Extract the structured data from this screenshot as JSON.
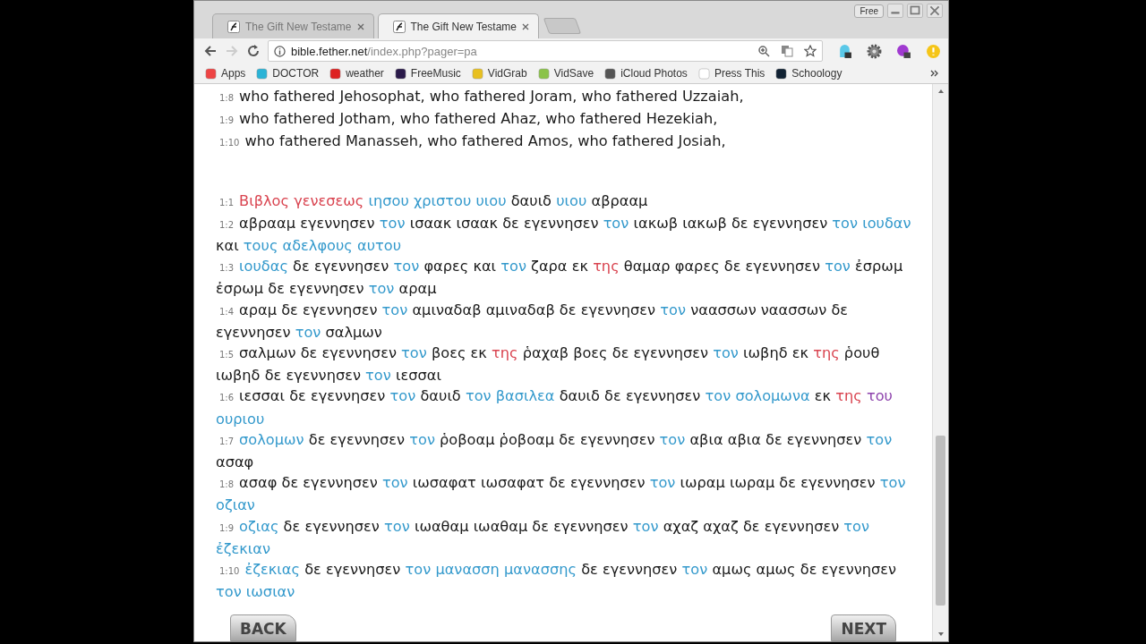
{
  "window": {
    "controls_label": "Free"
  },
  "tabs": [
    {
      "title": "The Gift New Testame",
      "selected": false
    },
    {
      "title": "The Gift New Testame",
      "selected": true
    }
  ],
  "address_bar": {
    "host": "bible.fether.net",
    "path": "/index.php?pager=pa"
  },
  "bookmarks": [
    "Apps",
    "DOCTOR",
    "weather",
    "FreeMusic",
    "VidGrab",
    "VidSave",
    "iCloud Photos",
    "Press This",
    "Schoology"
  ],
  "english_verses": [
    {
      "number": "1:8",
      "text": "who fathered Jehosophat, who fathered Joram, who fathered Uzzaiah,"
    },
    {
      "number": "1:9",
      "text": "who fathered Jotham, who fathered Ahaz, who fathered Hezekiah,"
    },
    {
      "number": "1:10",
      "text": "who fathered Manasseh, who fathered Amos, who fathered Josiah,"
    }
  ],
  "greek_verses": [
    {
      "number": "1:1",
      "segments": [
        {
          "text": "Βιβλος γενεσεως",
          "color": "#d9434f"
        },
        {
          "text": "ιησου χριστου υιου",
          "color": "#3399cc"
        },
        {
          "text": "δαυιδ",
          "color": "#1a1a1a"
        },
        {
          "text": "υιου",
          "color": "#3399cc"
        },
        {
          "text": "αβρααμ",
          "color": "#1a1a1a"
        }
      ]
    },
    {
      "number": "1:2",
      "segments": [
        {
          "text": "αβρααμ εγεννησεν",
          "color": "#1a1a1a"
        },
        {
          "text": "τον",
          "color": "#3399cc"
        },
        {
          "text": "ισαακ ισαακ δε εγεννησεν",
          "color": "#1a1a1a"
        },
        {
          "text": "τον",
          "color": "#3399cc"
        },
        {
          "text": "ιακωβ ιακωβ δε εγεννησεν",
          "color": "#1a1a1a"
        },
        {
          "text": "τον ιουδαν",
          "color": "#3399cc"
        },
        {
          "text": "και",
          "color": "#1a1a1a"
        },
        {
          "text": "τους αδελφους αυτου",
          "color": "#3399cc"
        }
      ]
    },
    {
      "number": "1:3",
      "segments": [
        {
          "text": "ιουδας",
          "color": "#3399cc"
        },
        {
          "text": "δε εγεννησεν",
          "color": "#1a1a1a"
        },
        {
          "text": "τον",
          "color": "#3399cc"
        },
        {
          "text": "φαρες και",
          "color": "#1a1a1a"
        },
        {
          "text": "τον",
          "color": "#3399cc"
        },
        {
          "text": "ζαρα εκ",
          "color": "#1a1a1a"
        },
        {
          "text": "της",
          "color": "#d9434f"
        },
        {
          "text": "θαμαρ φαρες δε εγεννησεν",
          "color": "#1a1a1a"
        },
        {
          "text": "τον",
          "color": "#3399cc"
        },
        {
          "text": "ἐσρωμ ἐσρωμ δε εγεννησεν",
          "color": "#1a1a1a"
        },
        {
          "text": "τον",
          "color": "#3399cc"
        },
        {
          "text": "αραμ",
          "color": "#1a1a1a"
        }
      ]
    },
    {
      "number": "1:4",
      "segments": [
        {
          "text": "αραμ δε εγεννησεν",
          "color": "#1a1a1a"
        },
        {
          "text": "τον",
          "color": "#3399cc"
        },
        {
          "text": "αμιναδαβ αμιναδαβ δε εγεννησεν",
          "color": "#1a1a1a"
        },
        {
          "text": "τον",
          "color": "#3399cc"
        },
        {
          "text": "ναασσων ναασσων δε εγεννησεν",
          "color": "#1a1a1a"
        },
        {
          "text": "τον",
          "color": "#3399cc"
        },
        {
          "text": "σαλμων",
          "color": "#1a1a1a"
        }
      ]
    },
    {
      "number": "1:5",
      "segments": [
        {
          "text": "σαλμων δε εγεννησεν",
          "color": "#1a1a1a"
        },
        {
          "text": "τον",
          "color": "#3399cc"
        },
        {
          "text": "βοες εκ",
          "color": "#1a1a1a"
        },
        {
          "text": "της",
          "color": "#d9434f"
        },
        {
          "text": "ῥαχαβ βοες δε εγεννησεν",
          "color": "#1a1a1a"
        },
        {
          "text": "τον",
          "color": "#3399cc"
        },
        {
          "text": "ιωβηδ εκ",
          "color": "#1a1a1a"
        },
        {
          "text": "της",
          "color": "#d9434f"
        },
        {
          "text": "ῥουθ ιωβηδ δε εγεννησεν",
          "color": "#1a1a1a"
        },
        {
          "text": "τον",
          "color": "#3399cc"
        },
        {
          "text": "ιεσσαι",
          "color": "#1a1a1a"
        }
      ]
    },
    {
      "number": "1:6",
      "segments": [
        {
          "text": "ιεσσαι δε εγεννησεν",
          "color": "#1a1a1a"
        },
        {
          "text": "τον",
          "color": "#3399cc"
        },
        {
          "text": "δαυιδ",
          "color": "#1a1a1a"
        },
        {
          "text": "τον βασιλεα",
          "color": "#3399cc"
        },
        {
          "text": "δαυιδ δε εγεννησεν",
          "color": "#1a1a1a"
        },
        {
          "text": "τον σολομωνα",
          "color": "#3399cc"
        },
        {
          "text": "εκ",
          "color": "#1a1a1a"
        },
        {
          "text": "της",
          "color": "#d9434f"
        },
        {
          "text": "του",
          "color": "#8e44ad"
        },
        {
          "text": "ουριου",
          "color": "#3399cc"
        }
      ]
    },
    {
      "number": "1:7",
      "segments": [
        {
          "text": "σολομων",
          "color": "#3399cc"
        },
        {
          "text": "δε εγεννησεν",
          "color": "#1a1a1a"
        },
        {
          "text": "τον",
          "color": "#3399cc"
        },
        {
          "text": "ῥοβοαμ ῥοβοαμ δε εγεννησεν",
          "color": "#1a1a1a"
        },
        {
          "text": "τον",
          "color": "#3399cc"
        },
        {
          "text": "αβια αβια δε εγεννησεν",
          "color": "#1a1a1a"
        },
        {
          "text": "τον",
          "color": "#3399cc"
        },
        {
          "text": "ασαφ",
          "color": "#1a1a1a"
        }
      ]
    },
    {
      "number": "1:8",
      "segments": [
        {
          "text": "ασαφ δε εγεννησεν",
          "color": "#1a1a1a"
        },
        {
          "text": "τον",
          "color": "#3399cc"
        },
        {
          "text": "ιωσαφατ ιωσαφατ δε εγεννησεν",
          "color": "#1a1a1a"
        },
        {
          "text": "τον",
          "color": "#3399cc"
        },
        {
          "text": "ιωραμ ιωραμ δε εγεννησεν",
          "color": "#1a1a1a"
        },
        {
          "text": "τον οζιαν",
          "color": "#3399cc"
        }
      ]
    },
    {
      "number": "1:9",
      "segments": [
        {
          "text": "οζιας",
          "color": "#3399cc"
        },
        {
          "text": "δε εγεννησεν",
          "color": "#1a1a1a"
        },
        {
          "text": "τον",
          "color": "#3399cc"
        },
        {
          "text": "ιωαθαμ ιωαθαμ δε εγεννησεν",
          "color": "#1a1a1a"
        },
        {
          "text": "τον",
          "color": "#3399cc"
        },
        {
          "text": "αχαζ αχαζ δε εγεννησεν",
          "color": "#1a1a1a"
        },
        {
          "text": "τον ἐζεκιαν",
          "color": "#3399cc"
        }
      ]
    },
    {
      "number": "1:10",
      "segments": [
        {
          "text": "ἐζεκιας",
          "color": "#3399cc"
        },
        {
          "text": "δε εγεννησεν",
          "color": "#1a1a1a"
        },
        {
          "text": "τον μανασση μανασσης",
          "color": "#3399cc"
        },
        {
          "text": "δε εγεννησεν",
          "color": "#1a1a1a"
        },
        {
          "text": "τον",
          "color": "#3399cc"
        },
        {
          "text": "αμως αμως δε εγεννησεν",
          "color": "#1a1a1a"
        },
        {
          "text": "τον ιωσιαν",
          "color": "#3399cc"
        }
      ]
    }
  ],
  "nav": {
    "back": "BACK",
    "next": "NEXT"
  }
}
